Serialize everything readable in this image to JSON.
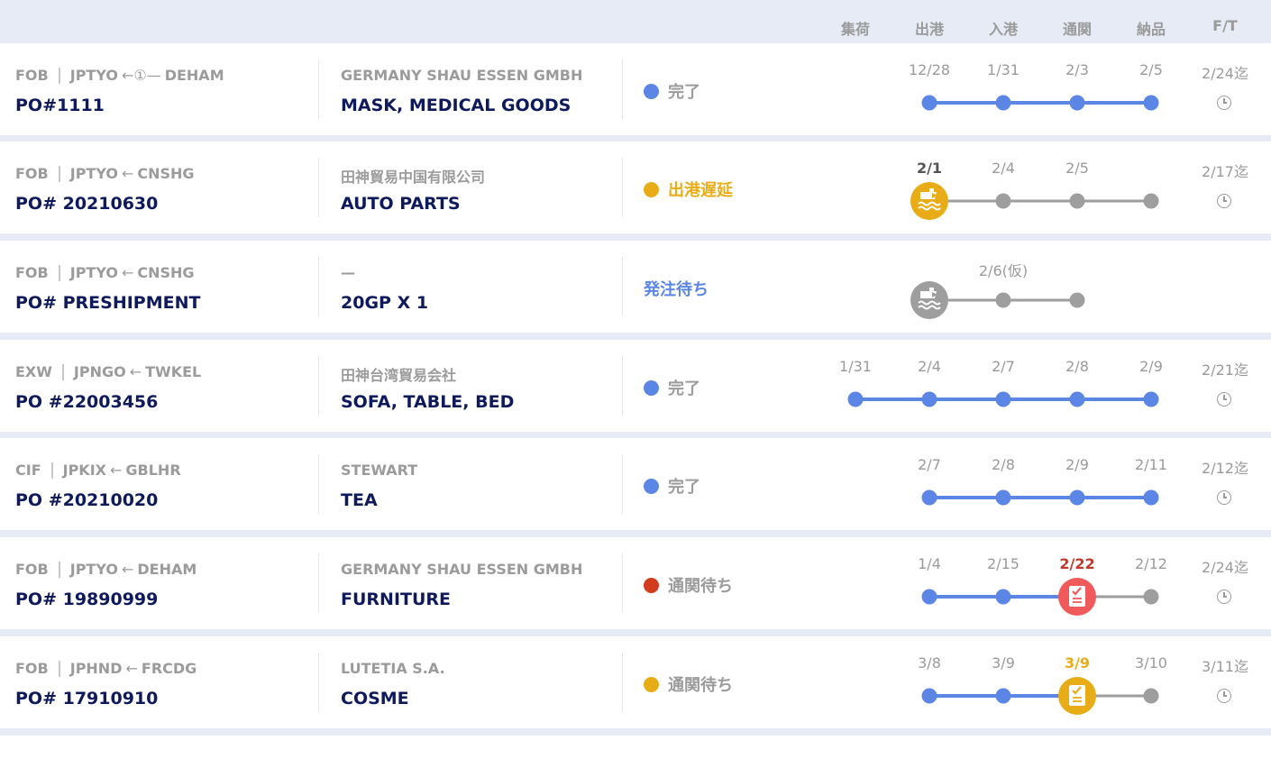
{
  "header": {
    "columns": [
      "集荷",
      "出港",
      "入港",
      "通関",
      "納品",
      "F/T"
    ]
  },
  "colors": {
    "blue": "#5b86e5",
    "gray": "#9e9e9e",
    "orange": "#e8ad16",
    "red": "#d13b1e",
    "red_icon": "#f05a5a",
    "navy": "#0f1a5c"
  },
  "shipments": [
    {
      "term": "FOB",
      "dest": "JPTYO",
      "arrow": "←①—",
      "origin": "DEHAM",
      "po": "PO#1111",
      "company": "GERMANY SHAU ESSEN GMBH",
      "goods": "MASK, MEDICAL GOODS",
      "status": {
        "label": "完了",
        "dot": "blue",
        "text_color": "#9b9b9b"
      },
      "ft": "2/24迄",
      "dates": [
        "",
        "12/28",
        "1/31",
        "2/3",
        "2/5"
      ],
      "highlight": [],
      "points": [
        {
          "col": 1,
          "type": "blue"
        },
        {
          "col": 2,
          "type": "blue"
        },
        {
          "col": 3,
          "type": "blue"
        },
        {
          "col": 4,
          "type": "blue"
        }
      ],
      "segments": [
        {
          "from": 1,
          "to": 4,
          "color": "blue"
        }
      ]
    },
    {
      "term": "FOB",
      "dest": "JPTYO",
      "arrow": "←",
      "origin": "CNSHG",
      "po": "PO# 20210630",
      "company": "田神貿易中国有限公司",
      "goods": "AUTO PARTS",
      "status": {
        "label": "出港遅延",
        "dot": "orange",
        "text_color": "#e8ad16"
      },
      "ft": "2/17迄",
      "dates": [
        "",
        "2/1",
        "2/4",
        "2/5",
        ""
      ],
      "highlight": [
        {
          "col": 1,
          "color": "#555555"
        }
      ],
      "points": [
        {
          "col": 1,
          "type": "icon",
          "icon": "ship-icon",
          "color": "orange"
        },
        {
          "col": 2,
          "type": "gray"
        },
        {
          "col": 3,
          "type": "gray"
        },
        {
          "col": 4,
          "type": "gray"
        }
      ],
      "segments": [
        {
          "from": 1,
          "to": 4,
          "color": "gray"
        }
      ]
    },
    {
      "term": "FOB",
      "dest": "JPTYO",
      "arrow": "←",
      "origin": "CNSHG",
      "po": "PO# PRESHIPMENT",
      "company": "—",
      "goods": "20GP X 1",
      "status": {
        "label": "発注待ち",
        "dot": "",
        "text_color": "#5b86e5"
      },
      "ft": "",
      "dates": [
        "",
        "",
        "2/6(仮)",
        "",
        ""
      ],
      "highlight": [],
      "points": [
        {
          "col": 1,
          "type": "icon",
          "icon": "ship-icon",
          "color": "gray"
        },
        {
          "col": 2,
          "type": "gray"
        },
        {
          "col": 3,
          "type": "gray"
        }
      ],
      "segments": [
        {
          "from": 1,
          "to": 3,
          "color": "gray"
        }
      ]
    },
    {
      "term": "EXW",
      "dest": "JPNGO",
      "arrow": "←",
      "origin": "TWKEL",
      "po": "PO #22003456",
      "company": "田神台湾貿易会社",
      "goods": "SOFA, TABLE, BED",
      "status": {
        "label": "完了",
        "dot": "blue",
        "text_color": "#9b9b9b"
      },
      "ft": "2/21迄",
      "dates": [
        "1/31",
        "2/4",
        "2/7",
        "2/8",
        "2/9"
      ],
      "highlight": [],
      "points": [
        {
          "col": 0,
          "type": "blue"
        },
        {
          "col": 1,
          "type": "blue"
        },
        {
          "col": 2,
          "type": "blue"
        },
        {
          "col": 3,
          "type": "blue"
        },
        {
          "col": 4,
          "type": "blue"
        }
      ],
      "segments": [
        {
          "from": 0,
          "to": 4,
          "color": "blue"
        }
      ]
    },
    {
      "term": "CIF",
      "dest": "JPKIX",
      "arrow": "←",
      "origin": "GBLHR",
      "po": "PO #20210020",
      "company": "STEWART",
      "goods": "TEA",
      "status": {
        "label": "完了",
        "dot": "blue",
        "text_color": "#9b9b9b"
      },
      "ft": "2/12迄",
      "dates": [
        "",
        "2/7",
        "2/8",
        "2/9",
        "2/11"
      ],
      "highlight": [],
      "points": [
        {
          "col": 1,
          "type": "blue"
        },
        {
          "col": 2,
          "type": "blue"
        },
        {
          "col": 3,
          "type": "blue"
        },
        {
          "col": 4,
          "type": "blue"
        }
      ],
      "segments": [
        {
          "from": 1,
          "to": 4,
          "color": "blue"
        }
      ]
    },
    {
      "term": "FOB",
      "dest": "JPTYO",
      "arrow": "←",
      "origin": "DEHAM",
      "po": "PO# 19890999",
      "company": "GERMANY SHAU ESSEN GMBH",
      "goods": "FURNITURE",
      "status": {
        "label": "通関待ち",
        "dot": "red",
        "text_color": "#9b9b9b"
      },
      "ft": "2/24迄",
      "dates": [
        "",
        "1/4",
        "2/15",
        "2/22",
        "2/12"
      ],
      "highlight": [
        {
          "col": 3,
          "color": "#c0392b"
        }
      ],
      "points": [
        {
          "col": 1,
          "type": "blue"
        },
        {
          "col": 2,
          "type": "blue"
        },
        {
          "col": 3,
          "type": "icon",
          "icon": "customs-check-icon",
          "color": "red_icon"
        },
        {
          "col": 4,
          "type": "gray"
        }
      ],
      "segments": [
        {
          "from": 1,
          "to": 3,
          "color": "blue"
        },
        {
          "from": 3,
          "to": 4,
          "color": "gray"
        }
      ]
    },
    {
      "term": "FOB",
      "dest": "JPHND",
      "arrow": "←",
      "origin": "FRCDG",
      "po": "PO# 17910910",
      "company": "LUTETIA S.A.",
      "goods": "COSME",
      "status": {
        "label": "通関待ち",
        "dot": "orange",
        "text_color": "#9b9b9b"
      },
      "ft": "3/11迄",
      "dates": [
        "",
        "3/8",
        "3/9",
        "3/9",
        "3/10"
      ],
      "highlight": [
        {
          "col": 3,
          "color": "#e8ad16"
        }
      ],
      "points": [
        {
          "col": 1,
          "type": "blue"
        },
        {
          "col": 2,
          "type": "blue"
        },
        {
          "col": 3,
          "type": "icon",
          "icon": "customs-check-icon",
          "color": "orange"
        },
        {
          "col": 4,
          "type": "gray"
        }
      ],
      "segments": [
        {
          "from": 1,
          "to": 3,
          "color": "blue"
        },
        {
          "from": 3,
          "to": 4,
          "color": "gray"
        }
      ]
    }
  ]
}
